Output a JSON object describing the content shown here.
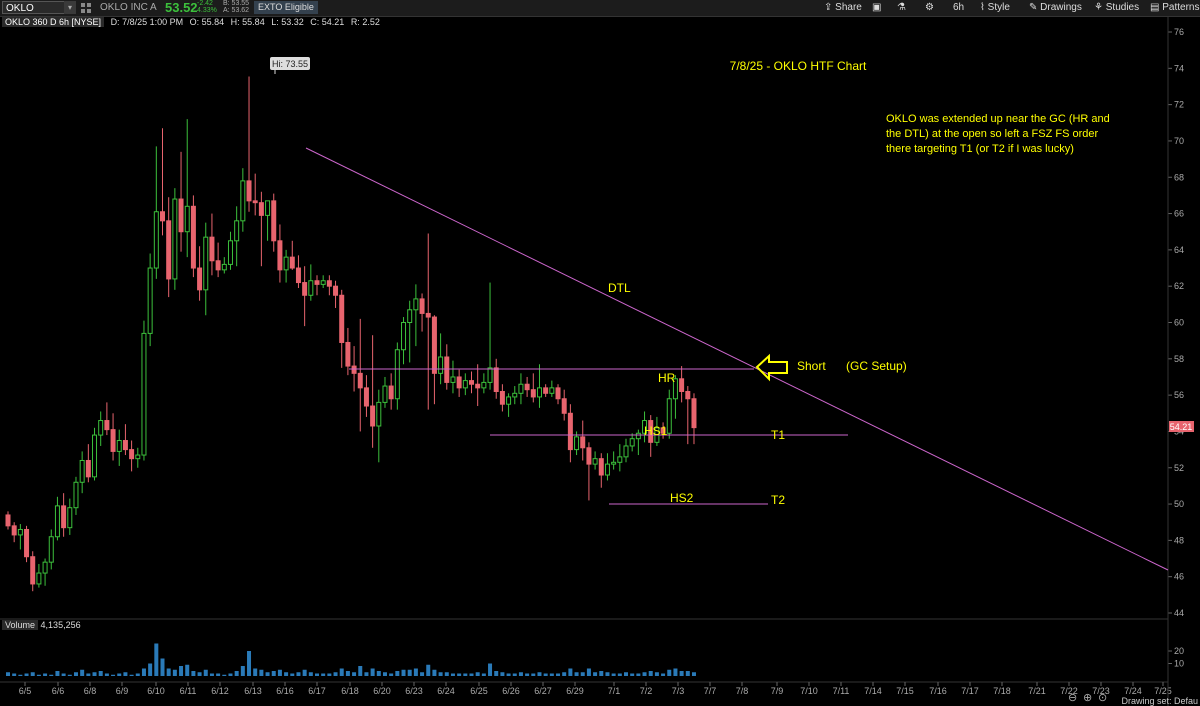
{
  "toolbar": {
    "symbol": "OKLO",
    "company": "OKLO INC A",
    "last": "53.52",
    "change": "-2.42",
    "change_pct": "4.33%",
    "bid": "B: 53.55",
    "ask": "A: 53.62",
    "exto": "EXTO Eligible",
    "share": "Share",
    "timeframe": "6h",
    "style": "Style",
    "drawings": "Drawings",
    "studies": "Studies",
    "patterns": "Patterns"
  },
  "infobar": {
    "symbol": "OKLO 360 D 6h [NYSE]",
    "date": "D: 7/8/25 1:00 PM",
    "open": "O: 55.84",
    "high": "H: 55.84",
    "low": "L: 53.32",
    "close": "C: 54.21",
    "range": "R: 2.52"
  },
  "volume": {
    "label": "Volume",
    "value": "4,135,256"
  },
  "drawing_set": "Drawing set: Defau",
  "annotations": {
    "title": "7/8/25 - OKLO HTF Chart",
    "note_line1": "OKLO was extended up near the GC (HR and",
    "note_line2": "the DTL) at the open so left a FSZ FS order",
    "note_line3": "there targeting T1 (or T2 if I was lucky)",
    "dtl": "DTL",
    "hr": "HR",
    "hs1": "HS1",
    "hs2": "HS2",
    "t1": "T1",
    "t2": "T2",
    "short": "Short",
    "gc_setup": "(GC Setup)",
    "hi_label": "Hi: 73.55",
    "last_price_tag": "54.21"
  },
  "colors": {
    "up": "#3cc03c",
    "down": "#e8646e",
    "trendline": "#cc66cc",
    "annotation": "#ffff00",
    "volume": "#2a7ab8"
  },
  "chart_data": {
    "type": "candlestick",
    "x_labels": [
      "6/5",
      "6/6",
      "6/8",
      "6/9",
      "6/10",
      "6/11",
      "6/12",
      "6/13",
      "6/16",
      "6/17",
      "6/18",
      "6/20",
      "6/23",
      "6/24",
      "6/25",
      "6/26",
      "6/27",
      "6/29",
      "7/1",
      "7/2",
      "7/3",
      "7/7",
      "7/8",
      "7/9",
      "7/10",
      "7/11",
      "7/14",
      "7/15",
      "7/16",
      "7/17",
      "7/18",
      "7/21",
      "7/22",
      "7/23",
      "7/24",
      "7/25"
    ],
    "y_ticks": [
      44,
      46,
      48,
      50,
      52,
      54,
      56,
      58,
      60,
      62,
      64,
      66,
      68,
      70,
      72,
      74,
      76
    ],
    "ylim": [
      43,
      76.5
    ],
    "volume_ticks": [
      10,
      20
    ],
    "candles": [
      [
        49.4,
        49.6,
        48.6,
        48.8
      ],
      [
        48.8,
        49.0,
        47.9,
        48.3
      ],
      [
        48.3,
        48.9,
        47.5,
        48.6
      ],
      [
        48.6,
        48.8,
        46.8,
        47.1
      ],
      [
        47.1,
        47.4,
        45.2,
        45.6
      ],
      [
        45.6,
        46.7,
        45.4,
        46.2
      ],
      [
        46.2,
        47.0,
        45.5,
        46.8
      ],
      [
        46.8,
        48.6,
        46.4,
        48.2
      ],
      [
        48.2,
        50.4,
        48.0,
        49.9
      ],
      [
        49.9,
        50.6,
        48.2,
        48.7
      ],
      [
        48.7,
        50.3,
        48.3,
        49.8
      ],
      [
        49.8,
        51.5,
        49.4,
        51.2
      ],
      [
        51.2,
        52.9,
        50.6,
        52.4
      ],
      [
        52.4,
        53.3,
        51.2,
        51.5
      ],
      [
        51.5,
        54.2,
        51.3,
        53.8
      ],
      [
        53.8,
        55.1,
        53.2,
        54.6
      ],
      [
        54.6,
        55.6,
        53.8,
        54.1
      ],
      [
        54.1,
        55.0,
        52.4,
        52.9
      ],
      [
        52.9,
        54.1,
        52.1,
        53.5
      ],
      [
        53.5,
        54.4,
        52.7,
        53.0
      ],
      [
        53.0,
        53.5,
        51.8,
        52.5
      ],
      [
        52.5,
        53.1,
        52.0,
        52.7
      ],
      [
        52.7,
        60.1,
        52.4,
        59.4
      ],
      [
        59.4,
        63.8,
        58.7,
        63.0
      ],
      [
        63.0,
        69.7,
        62.4,
        66.1
      ],
      [
        66.1,
        70.7,
        64.8,
        65.6
      ],
      [
        65.6,
        66.9,
        61.4,
        62.4
      ],
      [
        62.4,
        67.4,
        61.8,
        66.8
      ],
      [
        66.8,
        69.4,
        63.9,
        65.0
      ],
      [
        65.0,
        71.2,
        63.6,
        66.4
      ],
      [
        66.4,
        67.0,
        62.5,
        63.0
      ],
      [
        63.0,
        64.2,
        61.2,
        61.8
      ],
      [
        61.8,
        65.5,
        60.4,
        64.7
      ],
      [
        64.7,
        66.0,
        62.6,
        63.4
      ],
      [
        63.4,
        64.4,
        62.5,
        62.9
      ],
      [
        62.9,
        63.6,
        62.7,
        63.2
      ],
      [
        63.2,
        65.0,
        62.9,
        64.5
      ],
      [
        64.5,
        66.4,
        63.1,
        65.6
      ],
      [
        65.6,
        68.5,
        65.0,
        67.8
      ],
      [
        67.8,
        73.55,
        66.1,
        66.7
      ],
      [
        66.7,
        68.2,
        65.9,
        66.6
      ],
      [
        66.6,
        67.2,
        63.1,
        65.9
      ],
      [
        65.9,
        66.7,
        64.5,
        66.7
      ],
      [
        66.7,
        67.1,
        63.9,
        64.5
      ],
      [
        64.5,
        65.4,
        62.2,
        62.9
      ],
      [
        62.9,
        64.0,
        62.2,
        63.6
      ],
      [
        63.6,
        64.5,
        62.9,
        63.0
      ],
      [
        63.0,
        63.7,
        61.9,
        62.2
      ],
      [
        62.2,
        63.1,
        59.8,
        61.5
      ],
      [
        61.5,
        63.2,
        61.2,
        62.3
      ],
      [
        62.3,
        62.6,
        61.5,
        62.1
      ],
      [
        62.1,
        62.6,
        61.9,
        62.3
      ],
      [
        62.3,
        62.6,
        61.5,
        62.0
      ],
      [
        62.0,
        62.3,
        60.8,
        61.5
      ],
      [
        61.5,
        61.8,
        57.5,
        58.9
      ],
      [
        58.9,
        59.7,
        57.1,
        57.6
      ],
      [
        57.6,
        58.7,
        56.2,
        57.2
      ],
      [
        57.2,
        60.2,
        54.0,
        56.4
      ],
      [
        56.4,
        57.1,
        54.8,
        55.4
      ],
      [
        55.4,
        59.3,
        53.1,
        54.3
      ],
      [
        54.3,
        56.3,
        52.3,
        55.6
      ],
      [
        55.6,
        57.0,
        55.3,
        56.5
      ],
      [
        56.5,
        57.2,
        55.2,
        55.8
      ],
      [
        55.8,
        58.9,
        55.2,
        58.5
      ],
      [
        58.5,
        60.3,
        57.7,
        60.0
      ],
      [
        60.0,
        61.2,
        57.8,
        60.7
      ],
      [
        60.7,
        62.1,
        58.7,
        61.3
      ],
      [
        61.3,
        61.6,
        59.5,
        60.5
      ],
      [
        60.5,
        64.9,
        55.2,
        60.3
      ],
      [
        60.3,
        60.4,
        55.5,
        57.2
      ],
      [
        57.2,
        59.4,
        56.6,
        58.1
      ],
      [
        58.1,
        58.8,
        56.3,
        56.7
      ],
      [
        56.7,
        57.9,
        56.1,
        57.0
      ],
      [
        57.0,
        57.4,
        55.9,
        56.4
      ],
      [
        56.4,
        57.2,
        56.0,
        56.8
      ],
      [
        56.8,
        57.3,
        56.1,
        56.6
      ],
      [
        56.6,
        57.7,
        55.4,
        56.4
      ],
      [
        56.4,
        57.2,
        56.1,
        56.7
      ],
      [
        56.7,
        62.2,
        56.3,
        57.5
      ],
      [
        57.5,
        58.0,
        55.8,
        56.2
      ],
      [
        56.2,
        56.6,
        55.1,
        55.5
      ],
      [
        55.5,
        56.1,
        54.8,
        55.9
      ],
      [
        55.9,
        56.5,
        55.5,
        56.1
      ],
      [
        56.1,
        57.2,
        55.5,
        56.6
      ],
      [
        56.6,
        57.0,
        55.9,
        56.3
      ],
      [
        56.3,
        57.2,
        55.6,
        55.9
      ],
      [
        55.9,
        57.7,
        55.3,
        56.4
      ],
      [
        56.4,
        56.6,
        55.9,
        56.1
      ],
      [
        56.1,
        56.8,
        55.9,
        56.4
      ],
      [
        56.4,
        56.6,
        55.5,
        55.8
      ],
      [
        55.8,
        56.3,
        54.6,
        55.0
      ],
      [
        55.0,
        55.5,
        52.3,
        53.0
      ],
      [
        53.0,
        54.0,
        52.7,
        53.7
      ],
      [
        53.7,
        54.6,
        52.4,
        53.1
      ],
      [
        53.1,
        53.4,
        50.2,
        52.2
      ],
      [
        52.2,
        52.9,
        51.9,
        52.5
      ],
      [
        52.5,
        52.8,
        50.9,
        51.6
      ],
      [
        51.6,
        52.8,
        51.3,
        52.2
      ],
      [
        52.2,
        52.9,
        51.9,
        52.3
      ],
      [
        52.3,
        53.3,
        51.8,
        52.6
      ],
      [
        52.6,
        53.6,
        52.3,
        53.2
      ],
      [
        53.2,
        53.9,
        52.9,
        53.6
      ],
      [
        53.6,
        54.1,
        52.7,
        53.9
      ],
      [
        53.9,
        55.1,
        53.4,
        54.6
      ],
      [
        54.6,
        54.9,
        52.6,
        53.4
      ],
      [
        53.4,
        54.8,
        53.2,
        54.2
      ],
      [
        54.2,
        54.5,
        53.6,
        53.9
      ],
      [
        53.9,
        56.3,
        53.6,
        55.8
      ],
      [
        55.8,
        57.1,
        54.7,
        56.9
      ],
      [
        56.9,
        57.6,
        55.6,
        56.2
      ],
      [
        56.2,
        56.5,
        53.3,
        55.8
      ],
      [
        55.8,
        56.1,
        53.3,
        54.21
      ]
    ]
  }
}
